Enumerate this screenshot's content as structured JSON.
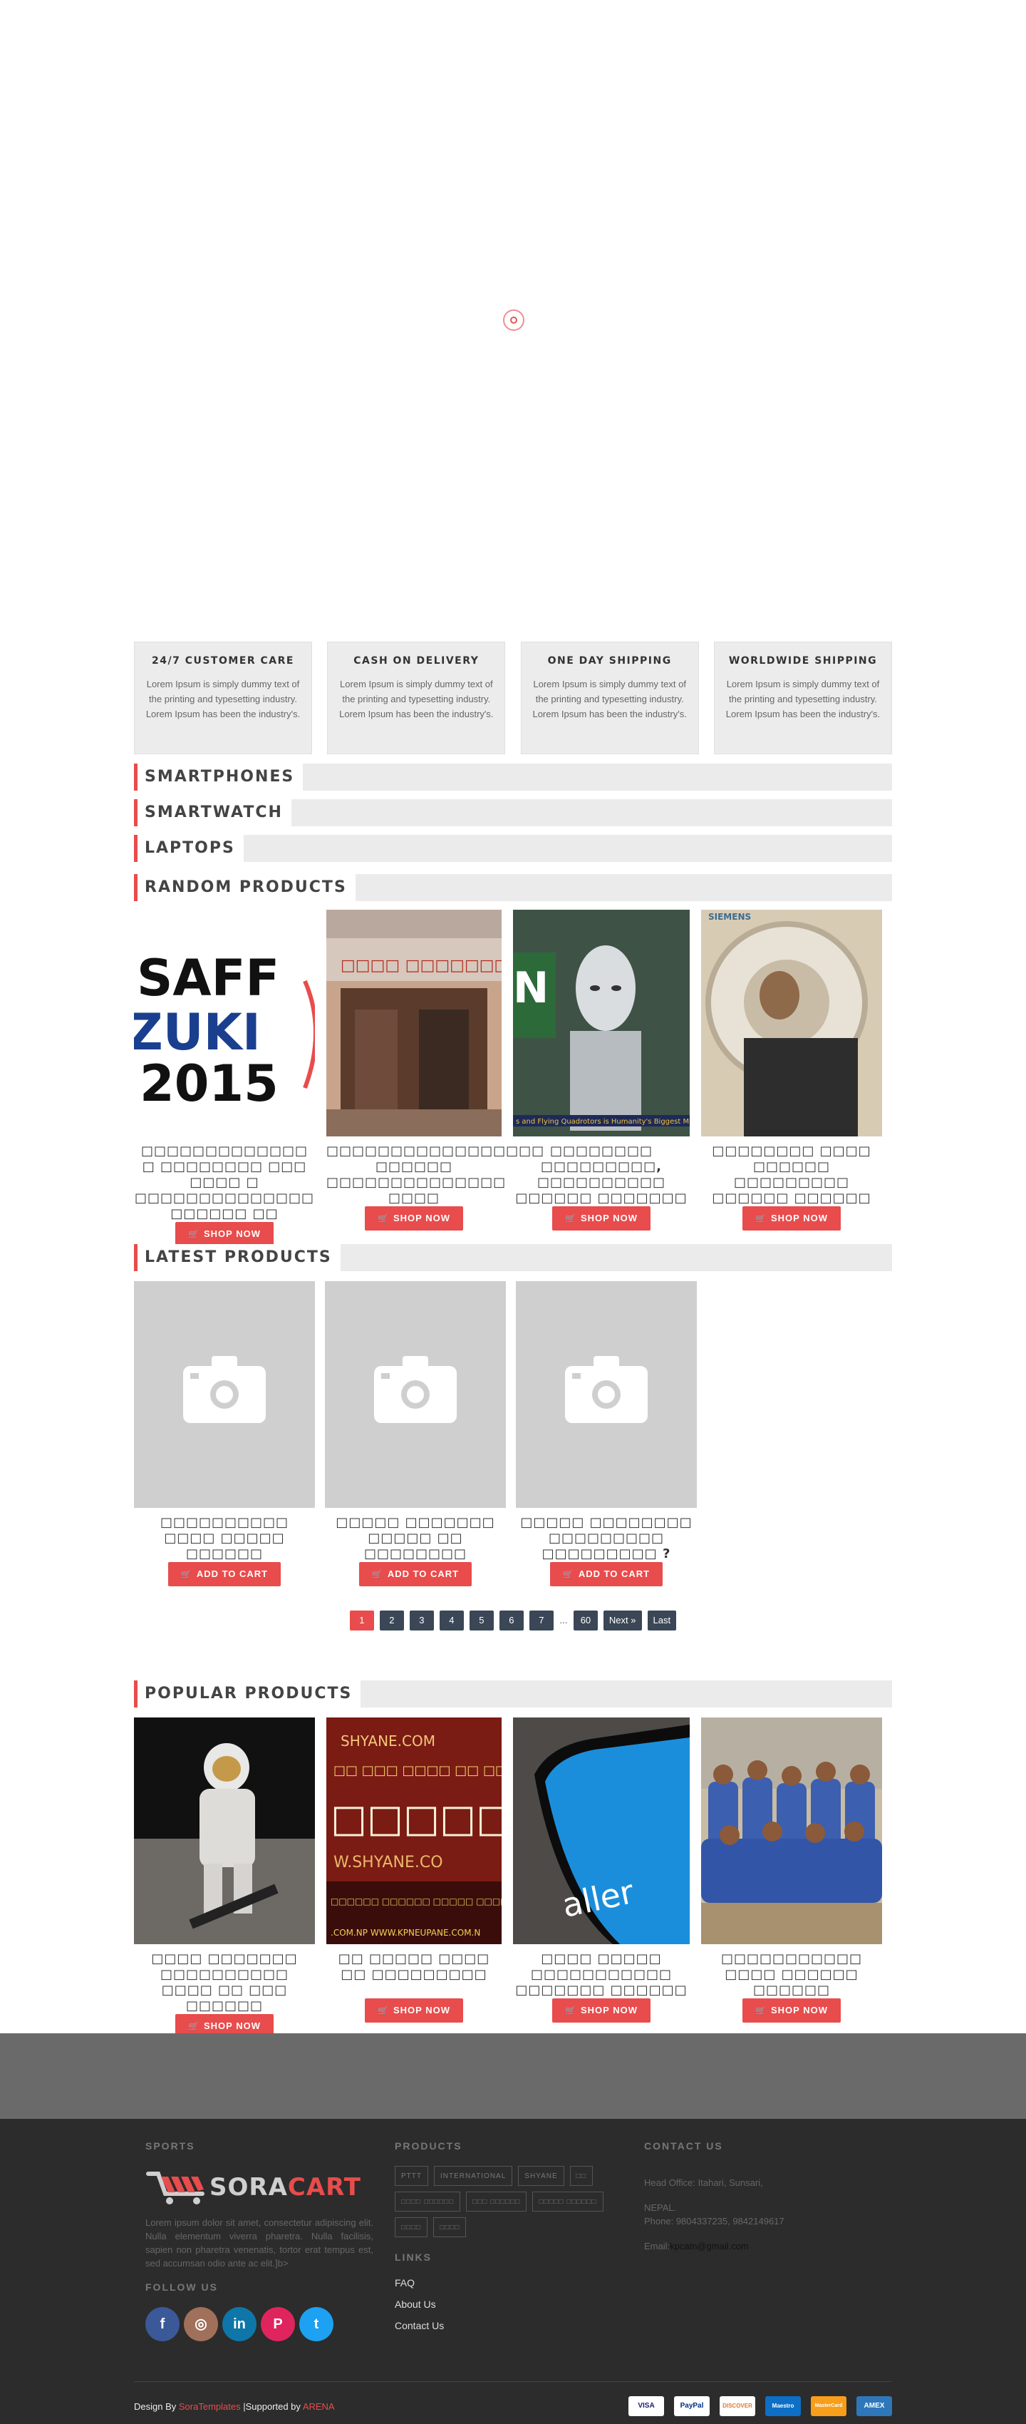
{
  "features": [
    {
      "title": "24/7 CUSTOMER CARE",
      "text": "Lorem Ipsum is simply dummy text of the printing and typesetting industry. Lorem Ipsum has been the industry's."
    },
    {
      "title": "CASH ON DELIVERY",
      "text": "Lorem Ipsum is simply dummy text of the printing and typesetting industry. Lorem Ipsum has been the industry's."
    },
    {
      "title": "ONE DAY SHIPPING",
      "text": "Lorem Ipsum is simply dummy text of the printing and typesetting industry. Lorem Ipsum has been the industry's."
    },
    {
      "title": "WORLDWIDE SHIPPING",
      "text": "Lorem Ipsum is simply dummy text of the printing and typesetting industry. Lorem Ipsum has been the industry's."
    }
  ],
  "sections": {
    "smartphones": "SMARTPHONES",
    "smartwatch": "SMARTWATCH",
    "laptops": "LAPTOPS",
    "random": "RANDOM PRODUCTS",
    "latest": "LATEST PRODUCTS",
    "popular": "POPULAR PRODUCTS"
  },
  "random_products": [
    {
      "title": "□□□□□□□□□□□□□ □ □□□□□□□□ □□□ □□□□ □ □□□□□□□□□□□□□□ □□□□□□ □□",
      "image": "saff-suzuki-2015",
      "button": "SHOP NOW"
    },
    {
      "title": "□□□□□□□□□□□□□□□□□ □□□□□□ □□□□□□□□□□□□□□ □□□□",
      "image": "building-gate",
      "button": "SHOP NOW"
    },
    {
      "title": "□□□□□□□□ □□□□□□□□□, □□□□□□□□□□ □□□□□□ □□□□□□□",
      "image": "robot",
      "button": "SHOP NOW"
    },
    {
      "title": "□□□□□□□□ □□□□ □□□□□□ □□□□□□□□□ □□□□□□ □□□□□□",
      "image": "mri-patient",
      "button": "SHOP NOW"
    }
  ],
  "latest_products": [
    {
      "title": "□□□□□□□□□□ □□□□ □□□□□ □□□□□□",
      "button": "ADD TO CART"
    },
    {
      "title": "□□□□□ □□□□□□□ □□□□□ □□ □□□□□□□□",
      "button": "ADD TO CART"
    },
    {
      "title": "□□□□□ □□□□□□□□ □□□□□□□□□ □□□□□□□□□ ?",
      "button": "ADD TO CART"
    }
  ],
  "pagination": [
    "1",
    "2",
    "3",
    "4",
    "5",
    "6",
    "7",
    "...",
    "60",
    "Next »",
    "Last"
  ],
  "popular_products": [
    {
      "title": "□□□□ □□□□□□□ □□□□□□□□□□ □□□□ □□ □□□ □□□□□□",
      "image": "astronaut",
      "button": "SHOP NOW"
    },
    {
      "title": "□□ □□□□□ □□□□ □□ □□□□□□□□□",
      "image": "shubhakamana-banner",
      "button": "SHOP NOW"
    },
    {
      "title": "□□□□ □□□□□ □□□□□□□□□□□ □□□□□□□ □□□□□□",
      "image": "phone-screen",
      "button": "SHOP NOW"
    },
    {
      "title": "□□□□□□□□□□□ □□□□ □□□□□□ □□□□□□",
      "image": "team-photo",
      "button": "SHOP NOW"
    }
  ],
  "footer": {
    "sports_heading": "SPORTS",
    "logo_a": "SORA",
    "logo_b": "CART",
    "about": "Lorem ipsum dolor sit amet, consectetur adipiscing elit. Nulla elementum viverra pharetra. Nulla facilisis, sapien non pharetra venenatis, tortor erat tempus est, sed accumsan odio ante ac elit.]b>",
    "follow_heading": "FOLLOW US",
    "products_heading": "PRODUCTS",
    "tags": [
      "PTTT",
      "INTERNATIONAL",
      "SHYANE",
      "□□",
      "□□□□ □□□□□□",
      "□□□ □□□□□□",
      "□□□□□ □□□□□□",
      "□□□□",
      "□□□□"
    ],
    "links_heading": "LINKS",
    "links": [
      "FAQ",
      "About Us",
      "Contact Us"
    ],
    "contact_heading": "CONTACT US",
    "contact_office": "Head Office: Itahari, Sunsari,",
    "contact_country": "NEPAL.",
    "contact_phone": "Phone: 9804337235, 9842149617",
    "contact_email_label": "Email:",
    "contact_email": "kpcatn@gmail.com",
    "credit_prefix": "Design By ",
    "credit_sora": "SoraTemplates",
    "credit_mid": " |Supported by ",
    "credit_arena": "ARENA",
    "payments": [
      "VISA",
      "PayPal",
      "DISCOVER",
      "Maestro",
      "MasterCard",
      "AMEX"
    ]
  }
}
